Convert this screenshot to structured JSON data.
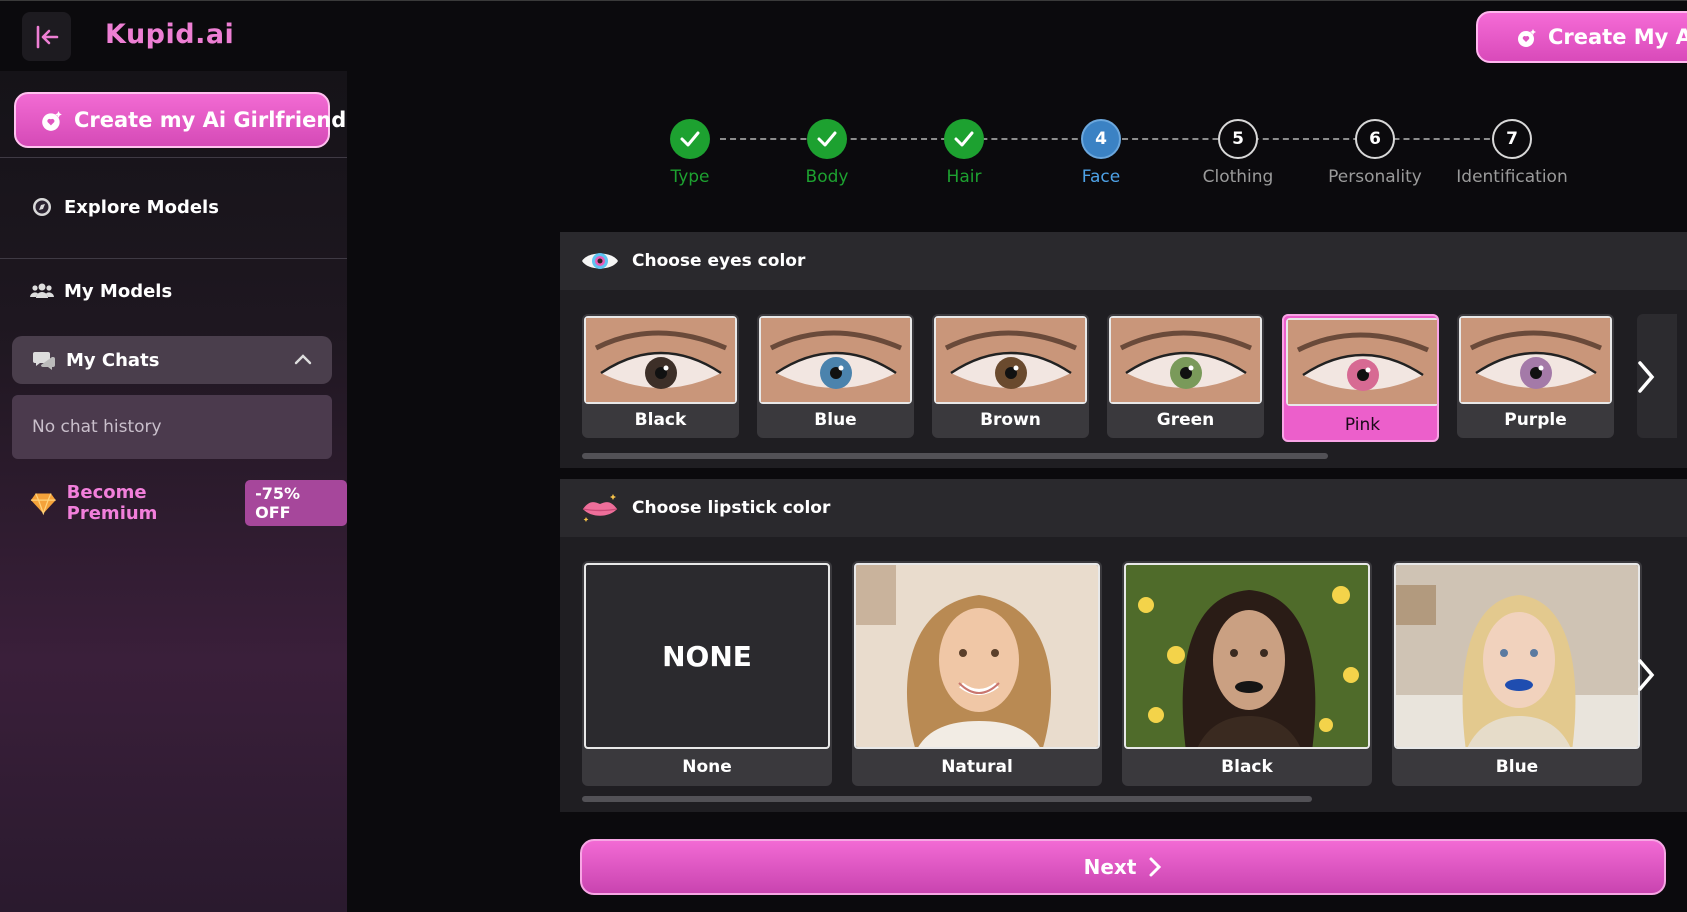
{
  "app": {
    "logo": "Kupid.ai"
  },
  "header": {
    "create_button": "Create My AI Girlfriend"
  },
  "sidebar": {
    "create_button": "Create my Ai Girlfriend",
    "explore": "Explore Models",
    "my_models": "My Models",
    "my_chats": "My Chats",
    "no_history": "No chat history",
    "premium_label": "Become Premium",
    "premium_badge": "-75% OFF"
  },
  "stepper": {
    "steps": [
      {
        "num": "",
        "label": "Type",
        "status": "done"
      },
      {
        "num": "",
        "label": "Body",
        "status": "done"
      },
      {
        "num": "",
        "label": "Hair",
        "status": "done"
      },
      {
        "num": "4",
        "label": "Face",
        "status": "active"
      },
      {
        "num": "5",
        "label": "Clothing",
        "status": "todo"
      },
      {
        "num": "6",
        "label": "Personality",
        "status": "todo"
      },
      {
        "num": "7",
        "label": "Identification",
        "status": "todo"
      }
    ]
  },
  "eyes": {
    "title": "Choose eyes color",
    "options": [
      {
        "label": "Black",
        "iris": "#3d2f28"
      },
      {
        "label": "Blue",
        "iris": "#4b83ad"
      },
      {
        "label": "Brown",
        "iris": "#6a4a2e"
      },
      {
        "label": "Green",
        "iris": "#7a9a5a"
      },
      {
        "label": "Pink",
        "iris": "#d76a93"
      },
      {
        "label": "Purple",
        "iris": "#a47aa8"
      }
    ],
    "selected": "Pink"
  },
  "lipstick": {
    "title": "Choose lipstick color",
    "none_text": "NONE",
    "options": [
      {
        "label": "None"
      },
      {
        "label": "Natural"
      },
      {
        "label": "Black"
      },
      {
        "label": "Blue"
      }
    ]
  },
  "next_button": "Next",
  "colors": {
    "accent": "#ec5fcb",
    "done": "#1da130",
    "active": "#3b82c4"
  }
}
